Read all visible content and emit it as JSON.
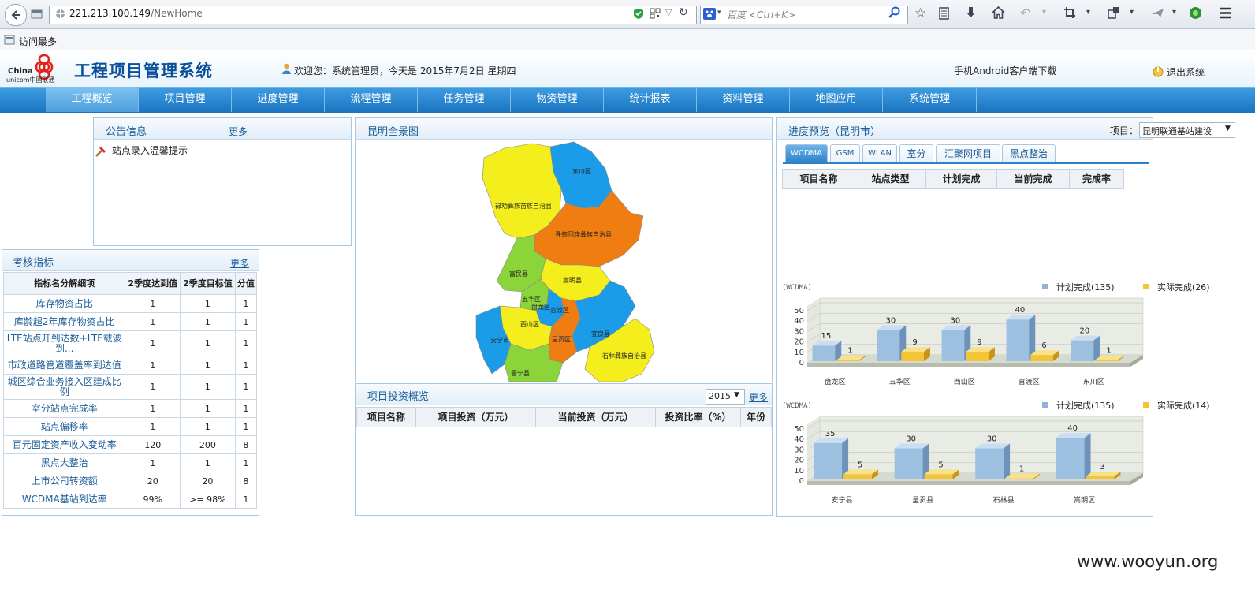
{
  "browser": {
    "url_host": "221.213.100.149",
    "url_path": "/NewHome",
    "search_placeholder": "百度 <Ctrl+K>",
    "bookmark": "访问最多"
  },
  "app": {
    "logo_line1": "China",
    "logo_line2": "unicom中国联通",
    "title": "工程项目管理系统",
    "welcome": "欢迎您：系统管理员，今天是 2015年7月2日 星期四",
    "android_link": "手机Android客户端下载",
    "logout": "退出系统"
  },
  "nav": [
    "工程概览",
    "项目管理",
    "进度管理",
    "流程管理",
    "任务管理",
    "物资管理",
    "统计报表",
    "资料管理",
    "地图应用",
    "系统管理"
  ],
  "notice": {
    "title": "公告信息",
    "more": "更多",
    "items": [
      "站点录入温馨提示"
    ]
  },
  "kpi": {
    "title": "考核指标",
    "more": "更多",
    "headers": [
      "指标名分解细项",
      "2季度达到值",
      "2季度目标值",
      "分值"
    ],
    "rows": [
      [
        "库存物资占比",
        "1",
        "1",
        "1"
      ],
      [
        "库龄超2年库存物资占比",
        "1",
        "1",
        "1"
      ],
      [
        "LTE站点开到达数+LTE载波到...",
        "1",
        "1",
        "1"
      ],
      [
        "市政道路管道覆盖率到达值",
        "1",
        "1",
        "1"
      ],
      [
        "城区综合业务接入区建成比例",
        "1",
        "1",
        "1"
      ],
      [
        "室分站点完成率",
        "1",
        "1",
        "1"
      ],
      [
        "站点偏移率",
        "1",
        "1",
        "1"
      ],
      [
        "百元固定资产收入变动率",
        "120",
        "200",
        "8"
      ],
      [
        "黑点大整治",
        "1",
        "1",
        "1"
      ],
      [
        "上市公司转资额",
        "20",
        "20",
        "8"
      ],
      [
        "WCDMA基站到达率",
        "99%",
        ">= 98%",
        "1"
      ]
    ]
  },
  "map": {
    "title": "昆明全景图",
    "regions": [
      "东川区",
      "禄劝彝族苗族自治县",
      "寻甸回族彝族自治县",
      "富民县",
      "嵩明县",
      "五华区",
      "官渡区",
      "西山区",
      "盘龙区",
      "呈贡区",
      "安宁市",
      "宜良县",
      "石林彝族自治县",
      "晋宁县"
    ],
    "colors": {
      "yellow": "#f4ef1c",
      "blue": "#1a9ce8",
      "orange": "#f07d12",
      "green": "#8bd43a"
    }
  },
  "invest": {
    "title": "项目投资概览",
    "year": "2015",
    "more": "更多",
    "headers": [
      "项目名称",
      "项目投资（万元）",
      "当前投资（万元）",
      "投资比率（%）",
      "年份"
    ]
  },
  "progress": {
    "title": "进度预览",
    "city": "（昆明市）",
    "project_label": "项目：",
    "project_value": "昆明联通基站建设",
    "tabs": [
      "WCDMA",
      "GSM",
      "WLAN",
      "室分",
      "汇聚网项目",
      "黑点整治"
    ],
    "headers": [
      "项目名称",
      "站点类型",
      "计划完成",
      "当前完成",
      "完成率"
    ]
  },
  "chart_data": [
    {
      "type": "bar",
      "title": "(WCDMA)",
      "categories": [
        "盘龙区",
        "五华区",
        "西山区",
        "官渡区",
        "东川区"
      ],
      "series": [
        {
          "name": "计划完成(135)",
          "values": [
            15,
            30,
            30,
            40,
            20
          ]
        },
        {
          "name": "实际完成(26)",
          "values": [
            1,
            9,
            9,
            6,
            1
          ]
        }
      ],
      "yticks": [
        "50",
        "40",
        "30",
        "20",
        "10",
        "0"
      ],
      "ylim": [
        0,
        50
      ],
      "legend": "top-right",
      "colors": [
        "#8fb4d6",
        "#f3c338"
      ]
    },
    {
      "type": "bar",
      "title": "(WCDMA)",
      "categories": [
        "安宁县",
        "呈贡县",
        "石林县",
        "嵩明区"
      ],
      "series": [
        {
          "name": "计划完成(135)",
          "values": [
            35,
            30,
            30,
            40
          ]
        },
        {
          "name": "实际完成(14)",
          "values": [
            5,
            5,
            1,
            3
          ]
        }
      ],
      "yticks": [
        "50",
        "40",
        "30",
        "20",
        "10",
        "0"
      ],
      "ylim": [
        0,
        50
      ],
      "legend": "top-right",
      "colors": [
        "#8fb4d6",
        "#f3c338"
      ]
    }
  ],
  "watermark": "www.wooyun.org"
}
